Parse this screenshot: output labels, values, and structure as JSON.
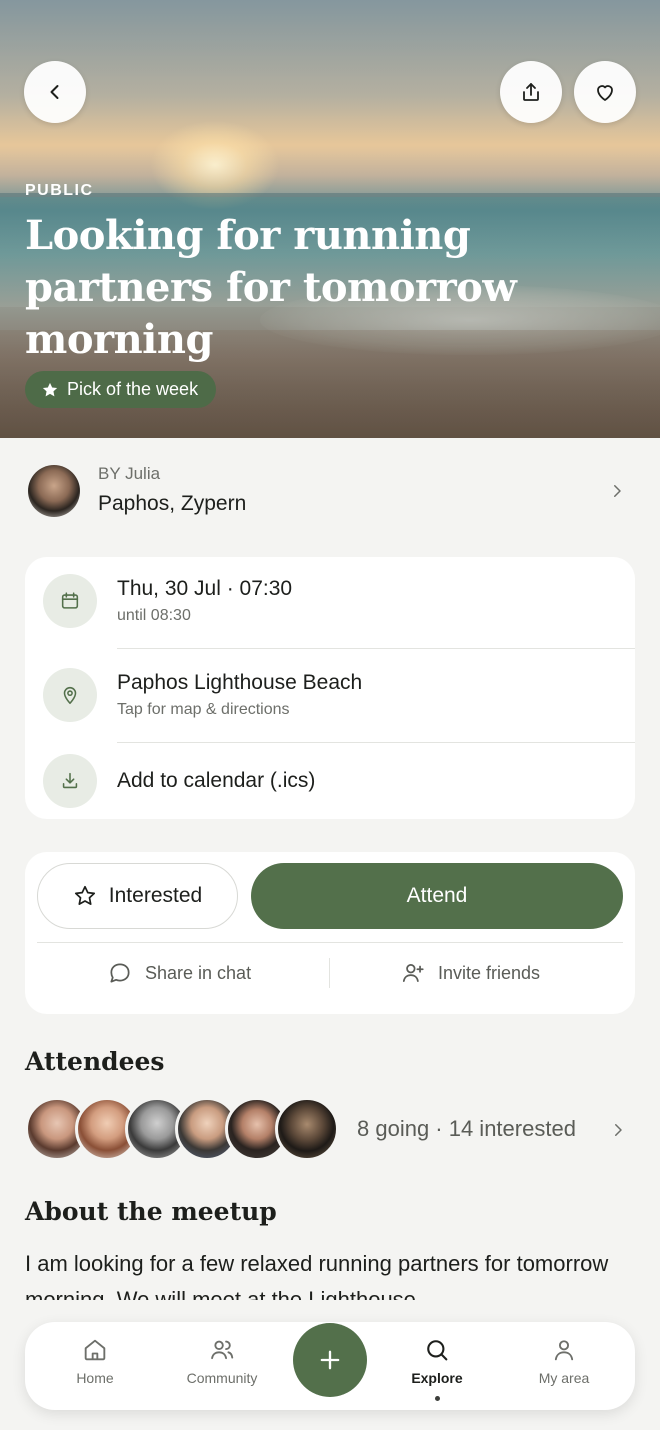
{
  "hero": {
    "visibility": "PUBLIC",
    "title": "Looking for running partners for tomorrow morning",
    "badge": "Pick of the week",
    "back_icon": "chevron-left-icon",
    "share_icon": "share-upload-icon",
    "favorite_icon": "heart-icon"
  },
  "host": {
    "by_label": "BY Julia",
    "location": "Paphos, Zypern"
  },
  "details": {
    "date": "Thu, 30 Jul · 07:30",
    "until": "until 08:30",
    "place": "Paphos Lighthouse Beach",
    "place_hint": "Tap for map & directions",
    "calendar": "Add to calendar (.ics)"
  },
  "actions": {
    "interested": "Interested",
    "attend": "Attend",
    "share_chat": "Share in chat",
    "invite": "Invite friends"
  },
  "attendees": {
    "heading": "Attendees",
    "summary": "8 going · 14 interested",
    "going_count": 8,
    "interested_count": 14
  },
  "about": {
    "heading": "About the meetup",
    "text": "I am looking for a few relaxed running partners for tomorrow morning. We will meet at the Lighthouse"
  },
  "nav": {
    "items": [
      {
        "label": "Home",
        "icon": "home-icon"
      },
      {
        "label": "Community",
        "icon": "users-icon"
      },
      {
        "label": "Explore",
        "icon": "search-icon"
      },
      {
        "label": "My area",
        "icon": "user-icon"
      }
    ],
    "active": "Explore"
  },
  "colors": {
    "accent": "#53704b",
    "badge": "#4e6b48",
    "background": "#f4f4f2"
  }
}
